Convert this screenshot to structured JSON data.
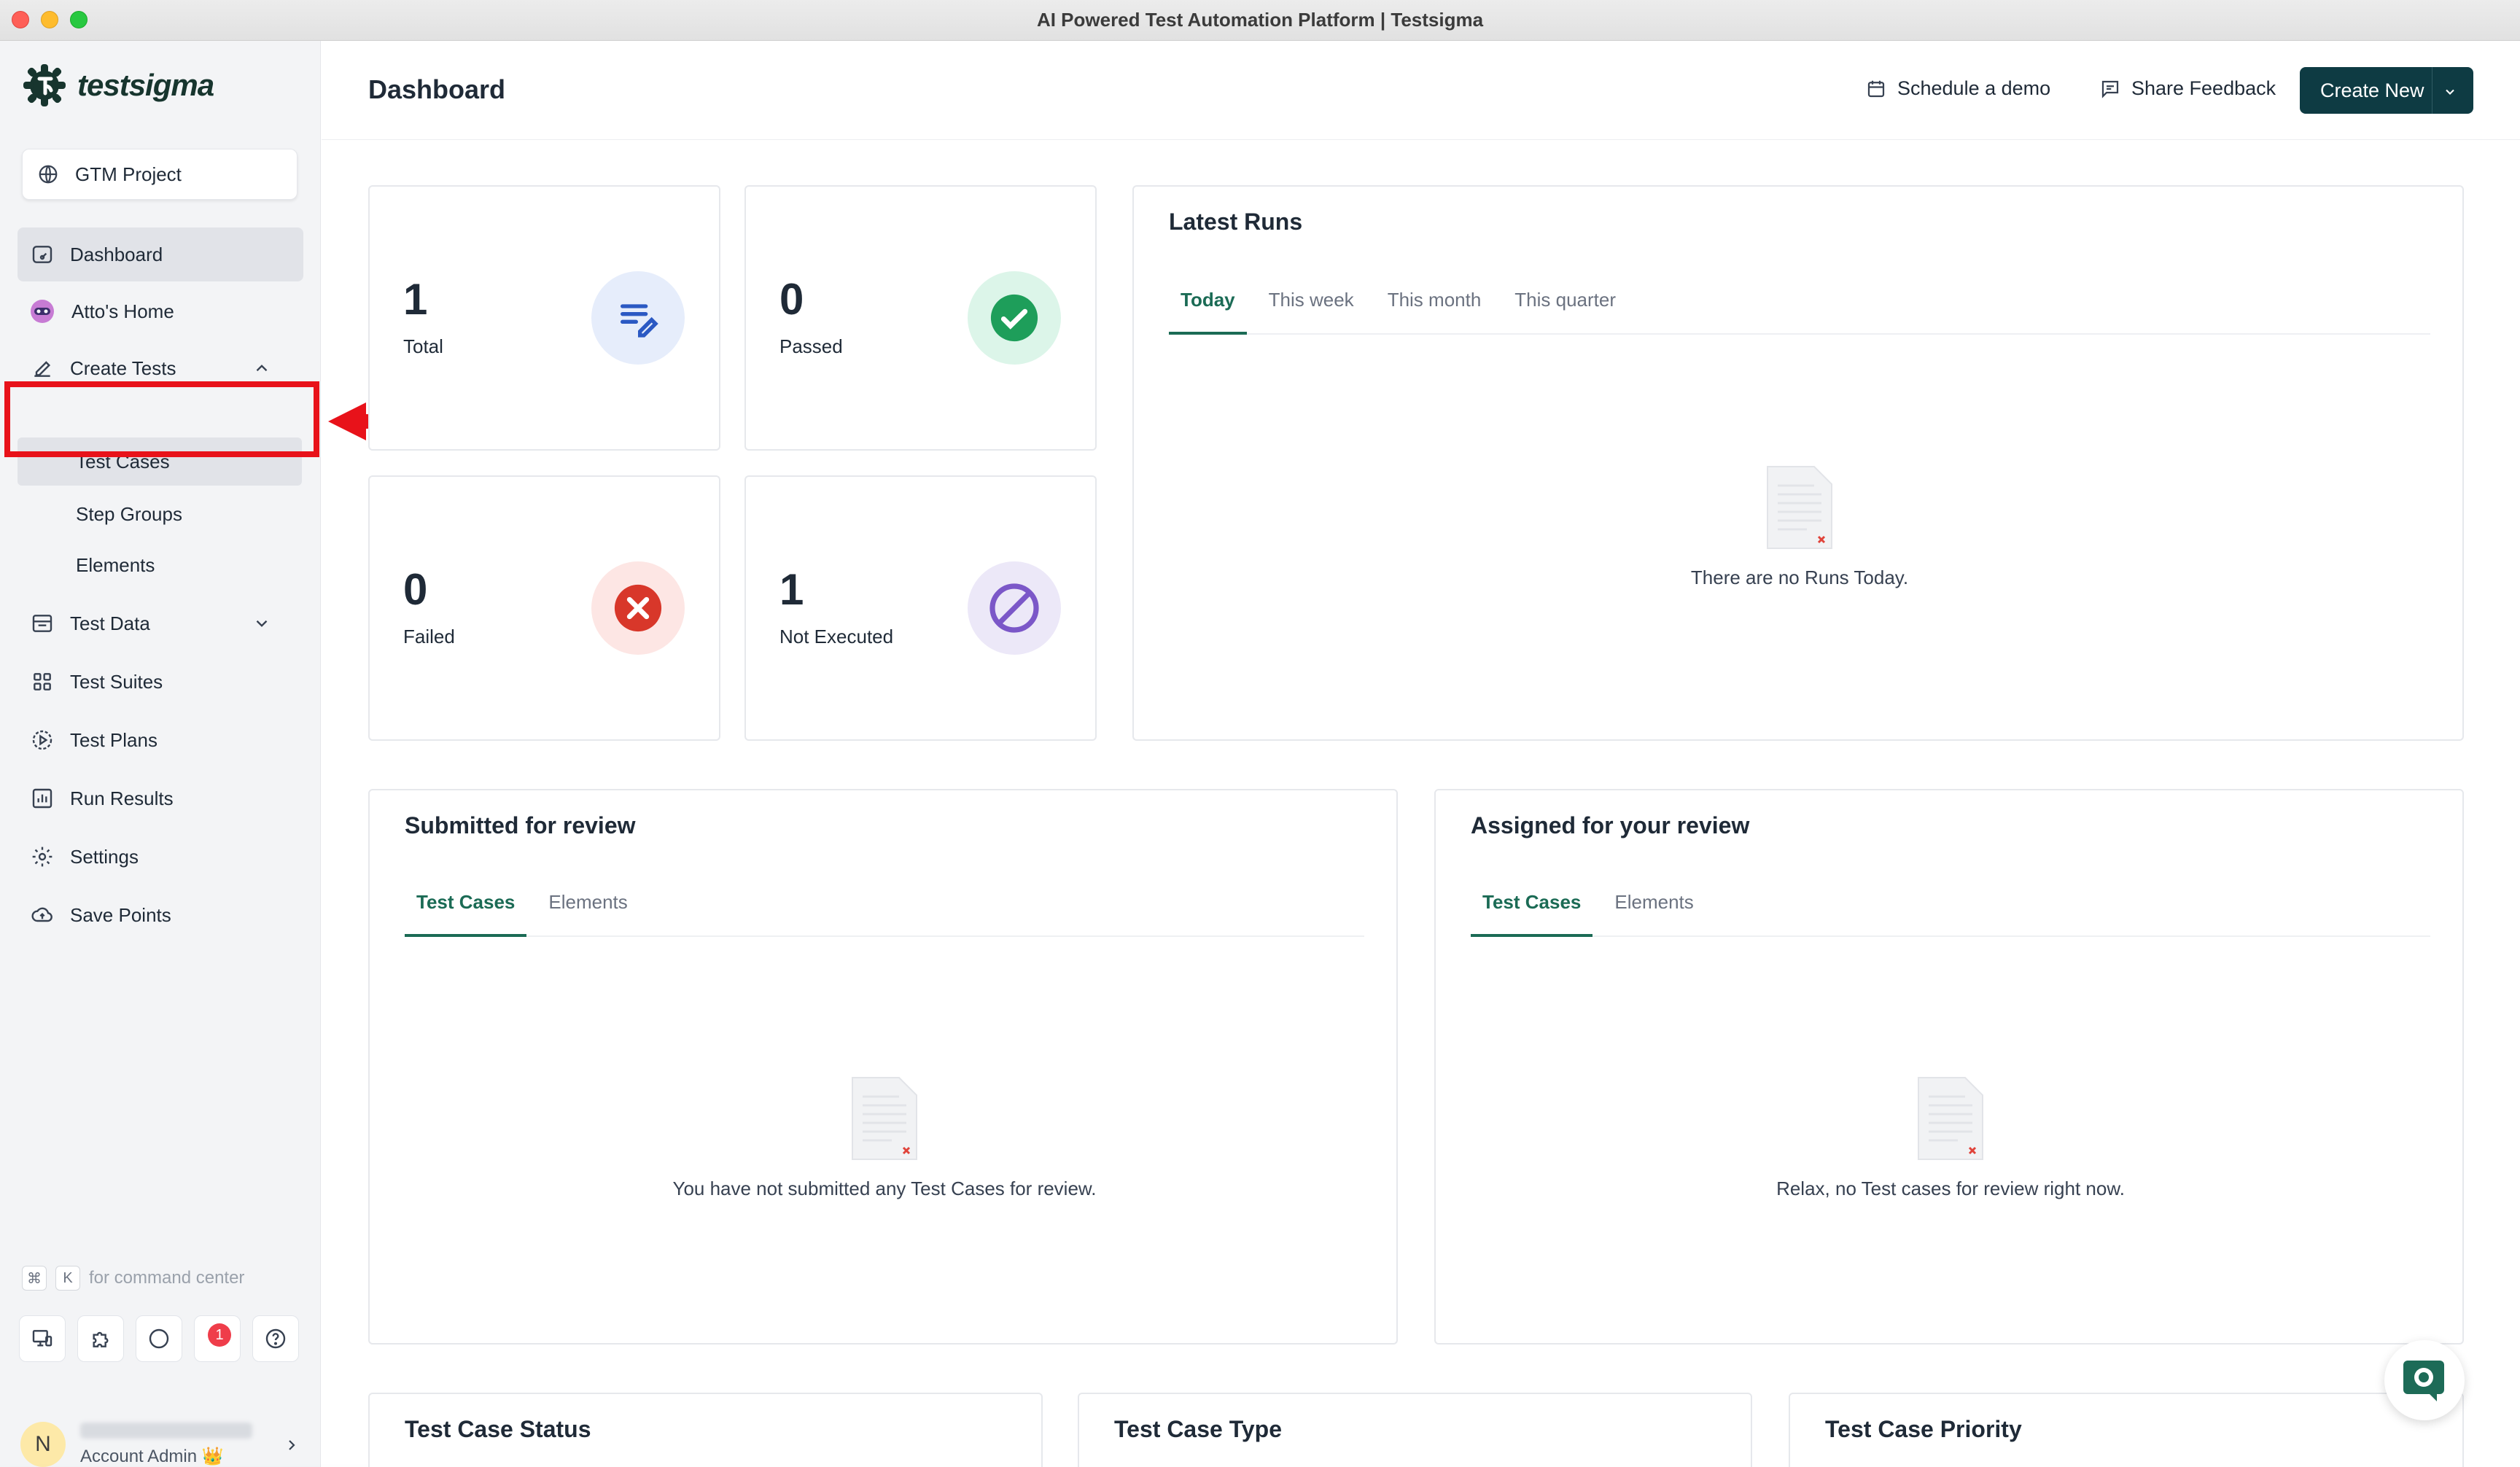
{
  "window": {
    "title": "AI Powered Test Automation Platform | Testsigma"
  },
  "brand": {
    "name": "testsigma",
    "color": "#17352e"
  },
  "colors": {
    "accent": "#1b6b55",
    "primary_button": "#0e3b43",
    "highlight": "#e8121a"
  },
  "sidebar": {
    "project": "GTM Project",
    "items": {
      "dashboard": "Dashboard",
      "attos_home": "Atto's Home",
      "create_tests": "Create Tests",
      "test_cases": "Test Cases",
      "step_groups": "Step Groups",
      "elements": "Elements",
      "test_data": "Test Data",
      "test_suites": "Test Suites",
      "test_plans": "Test Plans",
      "run_results": "Run Results",
      "settings": "Settings",
      "save_points": "Save Points"
    },
    "command_hint": {
      "key1": "⌘",
      "key2": "K",
      "text": "for command center"
    },
    "notification_count": "1",
    "user": {
      "initial": "N",
      "role": "Account Admin 👑"
    }
  },
  "header": {
    "title": "Dashboard",
    "schedule_demo": "Schedule a demo",
    "share_feedback": "Share Feedback",
    "create_new": "Create New"
  },
  "stats": {
    "total": {
      "value": "1",
      "label": "Total"
    },
    "passed": {
      "value": "0",
      "label": "Passed"
    },
    "failed": {
      "value": "0",
      "label": "Failed"
    },
    "not_executed": {
      "value": "1",
      "label": "Not Executed"
    }
  },
  "latest_runs": {
    "title": "Latest Runs",
    "tabs": [
      "Today",
      "This week",
      "This month",
      "This quarter"
    ],
    "empty": "There are no Runs Today."
  },
  "submitted_review": {
    "title": "Submitted for review",
    "tabs": [
      "Test Cases",
      "Elements"
    ],
    "empty": "You have not submitted any Test Cases for review."
  },
  "assigned_review": {
    "title": "Assigned for your review",
    "tabs": [
      "Test Cases",
      "Elements"
    ],
    "empty": "Relax, no Test cases for review right now."
  },
  "bottom_cards": {
    "status": "Test Case Status",
    "type": "Test Case Type",
    "priority": "Test Case Priority"
  }
}
